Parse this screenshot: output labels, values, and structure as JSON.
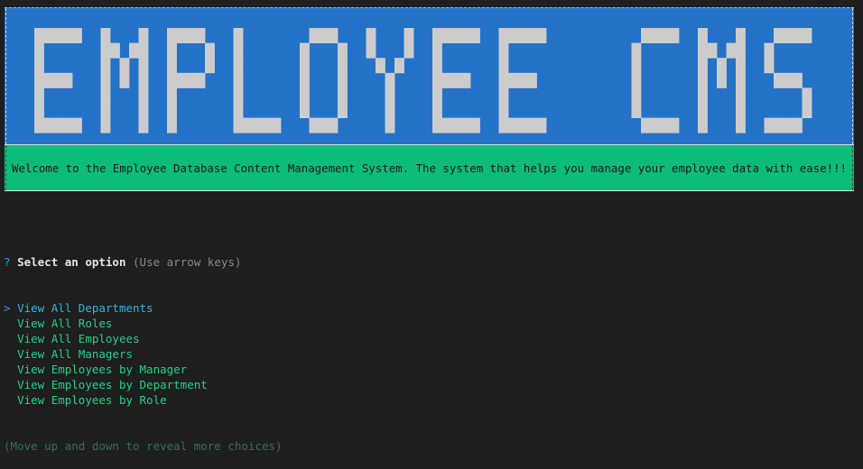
{
  "banner": {
    "title": "EMPLOYEE CMS",
    "background": "#2472c8",
    "letter_color": "#cccccc"
  },
  "welcome": {
    "text": "Welcome to the Employee Database Content Management System. The system that helps you manage your employee data with ease!!!",
    "background": "#0dbc79"
  },
  "prompt": {
    "qmark": "?",
    "question": "Select an option",
    "hint": "(Use arrow keys)",
    "pointer": ">",
    "choices": [
      {
        "label": "View All Departments",
        "selected": true
      },
      {
        "label": "View All Roles",
        "selected": false
      },
      {
        "label": "View All Employees",
        "selected": false
      },
      {
        "label": "View All Managers",
        "selected": false
      },
      {
        "label": "View Employees by Manager",
        "selected": false
      },
      {
        "label": "View Employees by Department",
        "selected": false
      },
      {
        "label": "View Employees by Role",
        "selected": false
      }
    ],
    "more_hint": "(Move up and down to reveal more choices)"
  }
}
